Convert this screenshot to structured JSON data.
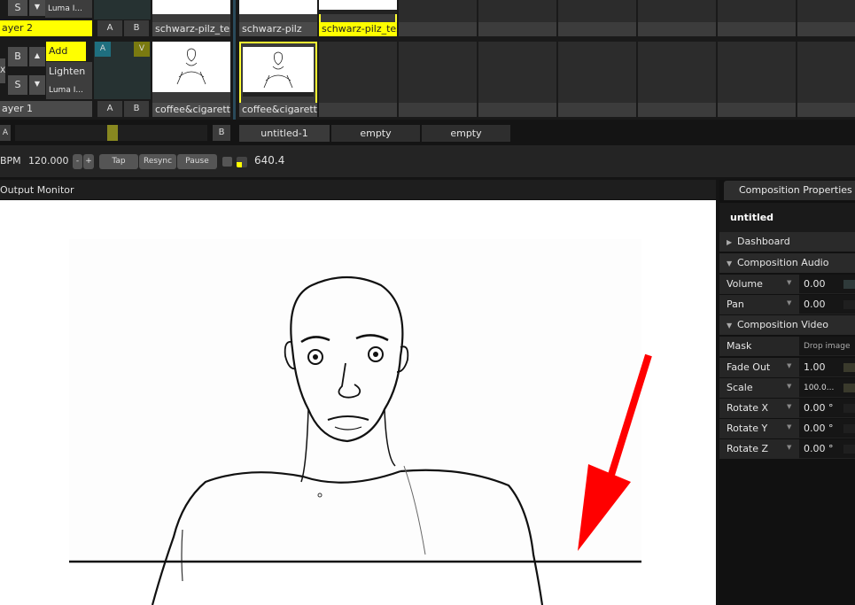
{
  "layers": [
    {
      "name": "ayer 2",
      "bypass": "S",
      "buttons": [
        "S"
      ],
      "blend_mode": "Luma I...",
      "a_label": "A",
      "b_label": "B",
      "clips": [
        "schwarz-pilz_test",
        "schwarz-pilz",
        "schwarz-pilz_test"
      ]
    },
    {
      "name": "ayer 1",
      "buttons": [
        "B",
        "S"
      ],
      "blend_modes": [
        "Add",
        "Lighten",
        "Luma I..."
      ],
      "a_label": "A",
      "b_label": "B",
      "v_label": "V",
      "clips": [
        "coffee&cigaretts",
        "coffee&cigaretts"
      ]
    }
  ],
  "crossfader": {
    "a_label": "A",
    "b_label": "B"
  },
  "decks": [
    "untitled-1",
    "empty",
    "empty"
  ],
  "tempo": {
    "bpm_label": "BPM",
    "bpm_value": "120.000",
    "minus": "-",
    "plus": "+",
    "tap": "Tap",
    "resync": "Resync",
    "pause": "Pause",
    "position": "640.4"
  },
  "monitor": {
    "title": "Output Monitor"
  },
  "properties": {
    "tab": "Composition Properties",
    "comp_name": "untitled",
    "sections": {
      "dashboard": "Dashboard",
      "audio": "Composition Audio",
      "video": "Composition Video"
    },
    "audio_rows": [
      {
        "label": "Volume",
        "value": "0.00"
      },
      {
        "label": "Pan",
        "value": "0.00"
      }
    ],
    "video_rows": [
      {
        "label": "Mask",
        "value": "Drop image"
      },
      {
        "label": "Fade Out",
        "value": "1.00"
      },
      {
        "label": "Scale",
        "value": "100.0..."
      },
      {
        "label": "Rotate X",
        "value": "0.00 °"
      },
      {
        "label": "Rotate Y",
        "value": "0.00 °"
      },
      {
        "label": "Rotate Z",
        "value": "0.00 °"
      }
    ]
  },
  "colors": {
    "accent": "#ffff00",
    "arrow": "#ff0000",
    "teal": "#1f6f7f",
    "olive": "#7a7a10"
  }
}
